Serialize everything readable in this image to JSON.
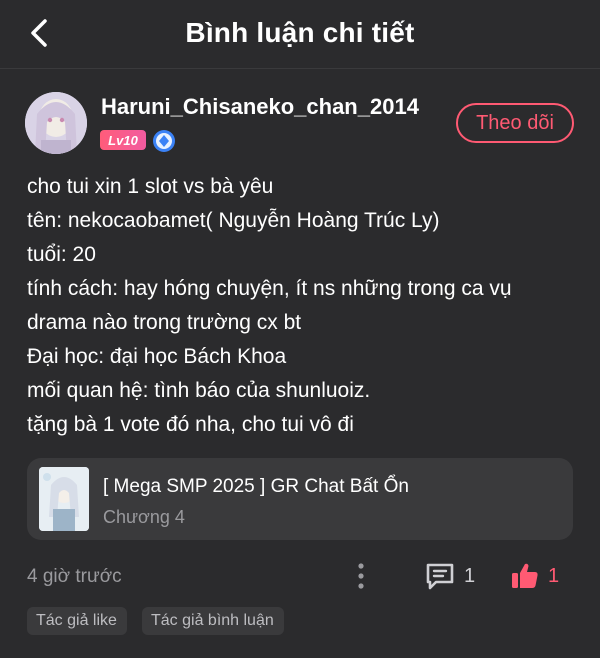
{
  "header": {
    "title": "Bình luận chi tiết",
    "back_icon": "chevron-left-icon"
  },
  "user": {
    "name": "Haruni_Chisaneko_chan_2014",
    "level": "Lv10",
    "verify_icon": "diamond-badge-icon",
    "follow_label": "Theo dõi"
  },
  "comment": {
    "lines": [
      "cho tui xin 1 slot vs bà yêu",
      "tên: nekocaobamet( Nguyễn Hoàng Trúc Ly)",
      "tuổi: 20",
      "tính cách: hay hóng chuyện, ít ns những trong ca vụ",
      "drama nào trong trường cx bt",
      "Đại học: đại học Bách Khoa",
      "mối quan hệ: tình báo của shunluoiz.",
      "tặng bà 1 vote đó nha, cho tui vô đi"
    ]
  },
  "chapter_card": {
    "story_title": "[ Mega SMP 2025 ] GR Chat Bất Ổn",
    "chapter": "Chương 4"
  },
  "footer": {
    "time": "4 giờ trước",
    "reply_count": "1",
    "like_count": "1",
    "tags": [
      "Tác giả like",
      "Tác giả bình luận"
    ]
  },
  "colors": {
    "background": "#2b2b2d",
    "card": "#3a3a3c",
    "accent": "#ff5a73",
    "muted_text": "#9a9a9e"
  }
}
